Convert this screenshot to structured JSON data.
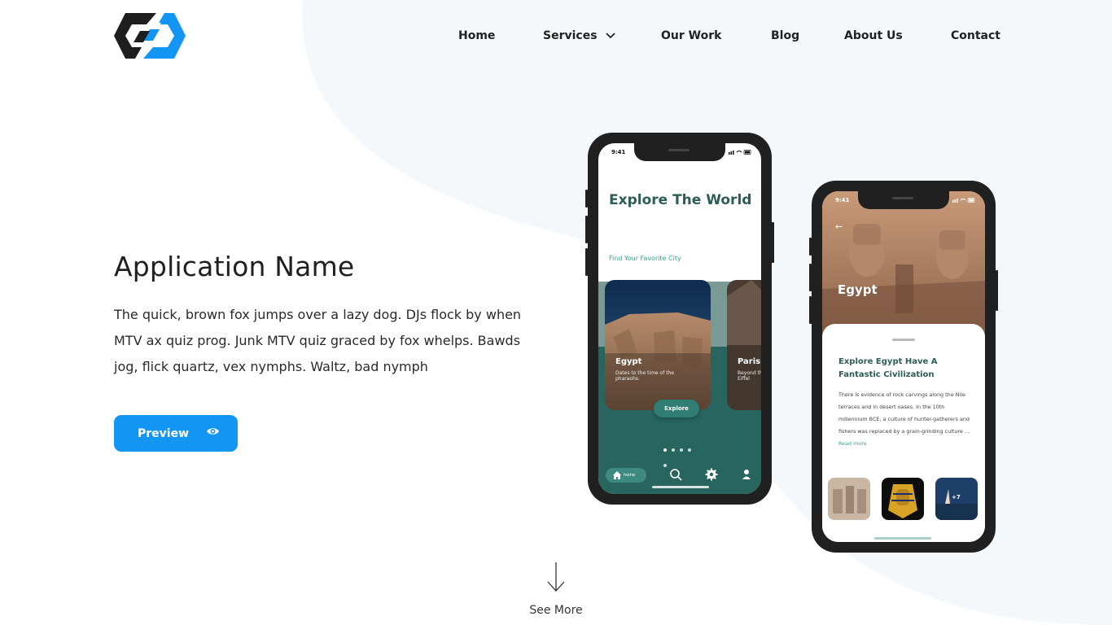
{
  "colors": {
    "accent": "#1396f3",
    "background_blob": "#f5f8fb",
    "app_teal": "#27655e",
    "app_mint": "#2ba58f",
    "phone_frame": "#202020"
  },
  "header": {
    "logo_icon": "hexagon-link-logo",
    "nav": {
      "home": "Home",
      "services": "Services",
      "our_work": "Our Work",
      "blog": "Blog",
      "about_us": "About Us",
      "contact": "Contact"
    }
  },
  "hero": {
    "title": "Application Name",
    "description": "The quick, brown fox jumps over a lazy dog. DJs flock by when MTV ax quiz prog. Junk MTV quiz graced by fox whelps. Bawds jog, flick quartz, vex nymphs. Waltz, bad nymph",
    "preview_label": "Preview",
    "preview_icon": "eye-icon"
  },
  "see_more": {
    "label": "See More",
    "icon": "arrow-down-icon"
  },
  "phone1": {
    "time": "9:41",
    "title": "Explore The World",
    "subtitle": "Find Your Favorite City",
    "cards": [
      {
        "name": "Egypt",
        "desc": "Dates to the time of the pharaohs."
      },
      {
        "name": "Paris",
        "desc": "Beyond the Eiffel"
      }
    ],
    "explore_label": "Explore",
    "carousel_active_index": 0,
    "tab_home_label": "home"
  },
  "phone2": {
    "time": "9:41",
    "hero_label": "Egypt",
    "title": "Explore Egypt Have A Fantastic Civilization",
    "text": "There is evidence of rock carvings along the Nile terraces and in desert oases. In the 10th millennium BCE, a culture of hunter-gatherers and fishers was replaced by a grain-grinding culture ...",
    "read_more": "Read more",
    "thumbs_more": "+7"
  }
}
